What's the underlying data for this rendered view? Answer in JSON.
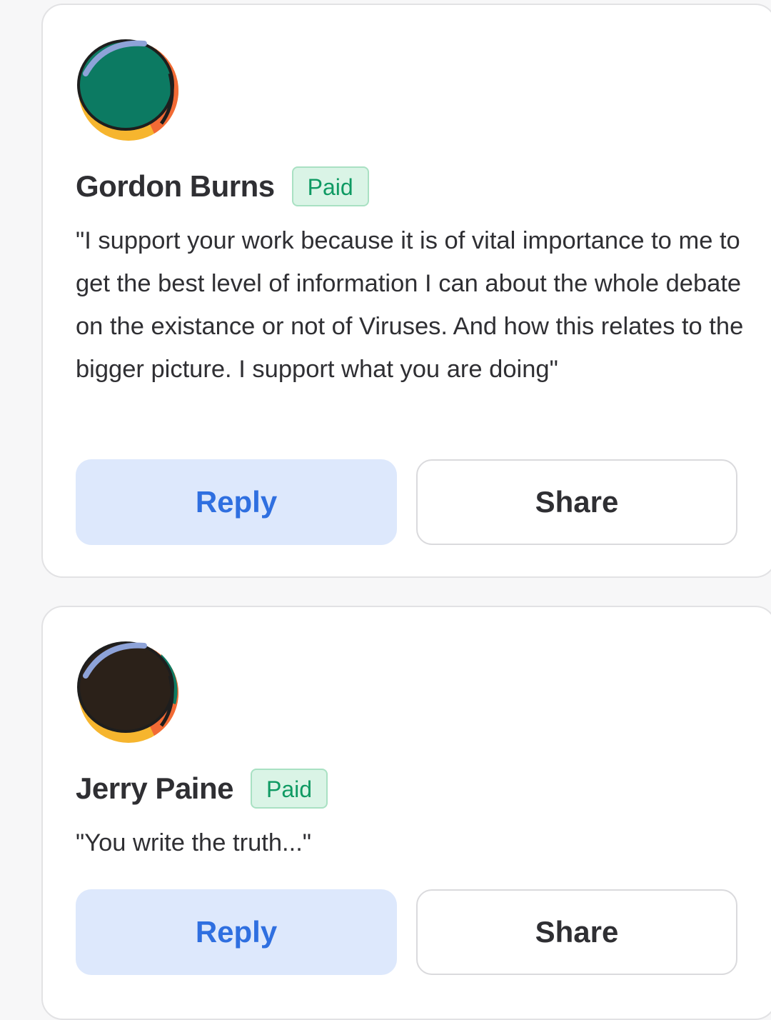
{
  "comments": [
    {
      "author": "Gordon Burns",
      "badge": "Paid",
      "text": "\"I support your work because it is of vital importance to me to get the best level of information I can about the whole debate on the existance or not of Viruses. And how this relates to the bigger picture. I support what you are doing\"",
      "avatar_colors": {
        "main": "#0c7a62",
        "rim_top": "#8ea3d8",
        "rim_bottom": "#f6b52e",
        "rim_right": "#f26a35",
        "outline": "#1e1e1e"
      },
      "reply_label": "Reply",
      "share_label": "Share"
    },
    {
      "author": "Jerry Paine",
      "badge": "Paid",
      "text": "\"You write the truth...\"",
      "avatar_colors": {
        "main": "#2b2119",
        "rim_top": "#8ea3d8",
        "rim_bottom": "#f6b52e",
        "rim_right": "#f26a35",
        "outline": "#1e1e1e"
      },
      "reply_label": "Reply",
      "share_label": "Share"
    }
  ],
  "colors": {
    "badge_bg": "#daf4e6",
    "badge_text": "#0f9a63",
    "reply_bg": "#dde8fc",
    "reply_text": "#2f6fe0"
  }
}
